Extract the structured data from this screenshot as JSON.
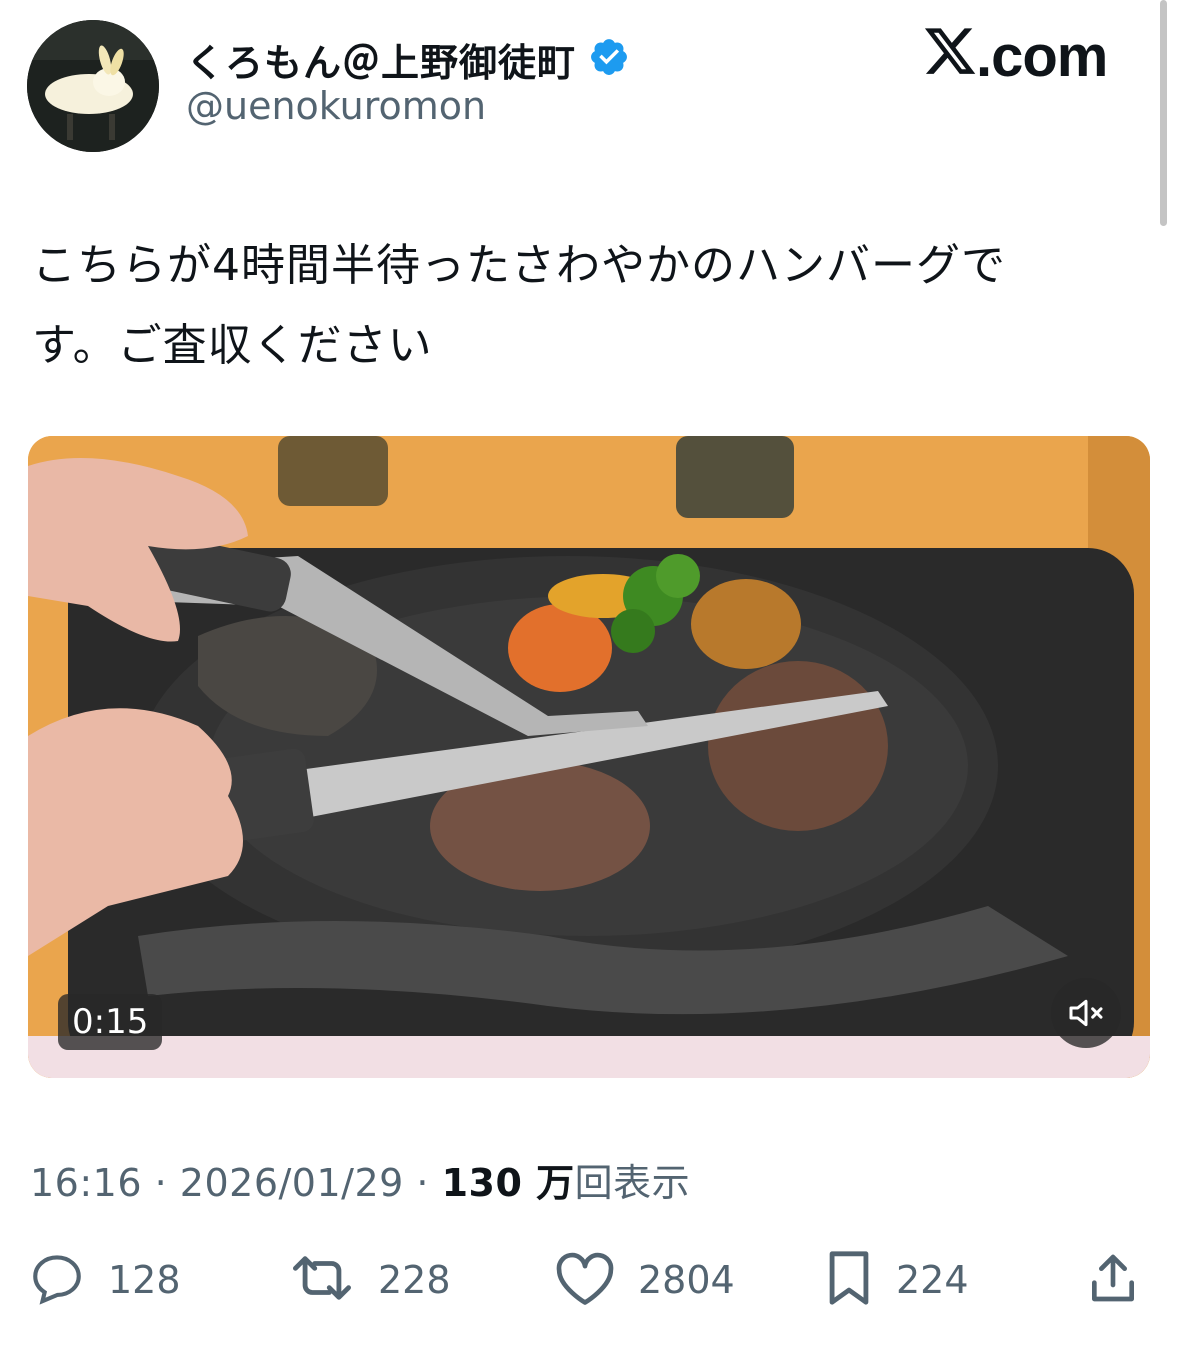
{
  "header": {
    "display_name": "くろもん＠上野御徒町",
    "handle": "@uenokuromon",
    "site_logo_text": ".com",
    "verified_color": "#1d9bf0"
  },
  "tweet": {
    "text_line1": "こちらが4時間半待ったさわやかのハンバーグで",
    "text_line2": "す。ご査収ください"
  },
  "media": {
    "duration": "0:15",
    "mute_icon": "speaker-muted-icon"
  },
  "meta": {
    "time": "16:16",
    "separator": "·",
    "date": "2026/01/29",
    "views_count": "130 万",
    "views_label": "回表示"
  },
  "actions": {
    "replies": "128",
    "retweets": "228",
    "likes": "2804",
    "bookmarks": "224"
  },
  "colors": {
    "text": "#0f1419",
    "secondary": "#536471",
    "accent": "#1d9bf0"
  }
}
